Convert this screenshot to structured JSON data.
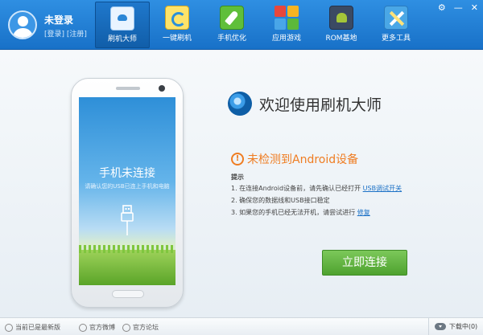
{
  "user": {
    "status": "未登录",
    "login_link": "[登录]",
    "register_link": "[注册]"
  },
  "nav": {
    "items": [
      {
        "label": "刷机大师",
        "icon": "cloud-flash-icon"
      },
      {
        "label": "一键刷机",
        "icon": "refresh-icon"
      },
      {
        "label": "手机优化",
        "icon": "rocket-icon"
      },
      {
        "label": "应用游戏",
        "icon": "apps-grid-icon"
      },
      {
        "label": "ROM基地",
        "icon": "android-icon"
      },
      {
        "label": "更多工具",
        "icon": "tools-icon"
      }
    ],
    "active": "刷机大师"
  },
  "window_controls": [
    "⚙",
    "—",
    "✕"
  ],
  "phone": {
    "screen_title": "手机未连接",
    "screen_subtitle": "请确认您的USB已连上手机和电脑"
  },
  "welcome_title": "欢迎使用刷机大师",
  "warning": {
    "icon": "!",
    "text": "未检测到Android设备"
  },
  "tips": {
    "title": "提示",
    "items": [
      {
        "text": "1. 在连接Android设备前，请先确认已经打开",
        "link": "USB调试开关"
      },
      {
        "text": "2. 确保您的数据线和USB接口稳定",
        "link": ""
      },
      {
        "text": "3. 如果您的手机已经无法开机，请尝试进行",
        "link": "修复"
      }
    ]
  },
  "connect_button": "立即连接",
  "statusbar": {
    "version": "当前已是最新版",
    "weibo": "官方微博",
    "forum": "官方论坛",
    "download": "下载中(0)"
  },
  "colors": {
    "topbar": "#1f7fd6",
    "accent_orange": "#ef7d22",
    "button_green": "#5fb23c",
    "link_blue": "#1a70c6"
  }
}
